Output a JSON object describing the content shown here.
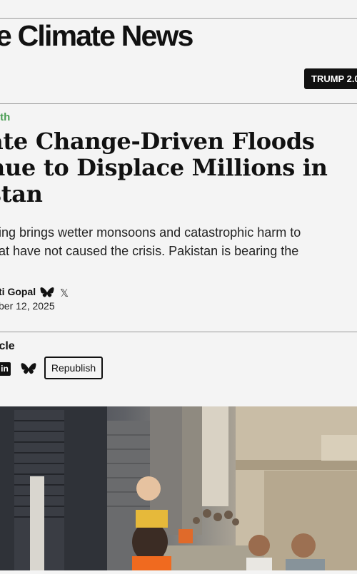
{
  "site": {
    "title": "e Climate News"
  },
  "nav": {
    "pill_label": "TRUMP 2.0:"
  },
  "article": {
    "category": "lth",
    "headline_lines": [
      "ate Change-Driven Floods",
      "nue to Displace Millions in",
      "stan"
    ],
    "dek_lines": [
      "ing brings wetter monsoons and catastrophic harm to",
      "at have not caused the crisis. Pakistan is bearing the"
    ],
    "author": "ti Gopal",
    "date": "ber 12, 2025"
  },
  "share": {
    "label": "icle",
    "linkedin_glyph": "in",
    "x_glyph": "𝕏",
    "republish_label": "Republish"
  },
  "icons": {
    "author_social": [
      "bluesky-icon",
      "x-icon"
    ],
    "share": [
      "linkedin-icon",
      "bluesky-icon"
    ]
  },
  "image": {
    "description_type": "photo"
  },
  "colors": {
    "category": "#4a9e54",
    "pill_bg": "#111111",
    "background": "#f4f4f4"
  }
}
